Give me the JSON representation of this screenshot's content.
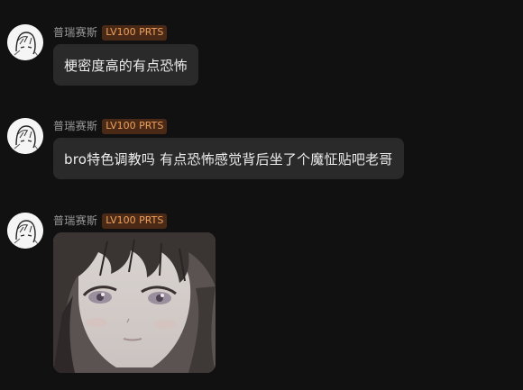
{
  "messages": [
    {
      "username": "普瑞赛斯",
      "badge": "LV100 PRTS",
      "text": "梗密度高的有点恐怖"
    },
    {
      "username": "普瑞赛斯",
      "badge": "LV100 PRTS",
      "text": "bro特色调教吗 有点恐怖感觉背后坐了个魔怔贴吧老哥"
    },
    {
      "username": "普瑞赛斯",
      "badge": "LV100 PRTS",
      "image": "anime-girl-face-sticker"
    }
  ],
  "colors": {
    "background": "#111111",
    "bubble": "#2a2a2a",
    "username": "#9a9a9a",
    "badge_bg": "#4a2a17",
    "badge_text": "#f0a05a"
  }
}
